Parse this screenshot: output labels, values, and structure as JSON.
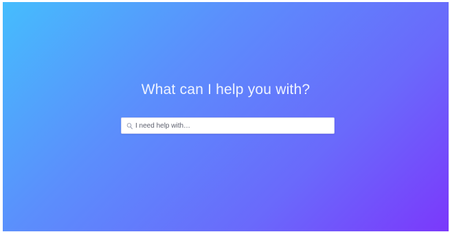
{
  "hero": {
    "headline": "What can I help you with?",
    "gradient_colors": [
      "#45bdfd",
      "#6a69fb",
      "#7b38fb"
    ]
  },
  "search": {
    "placeholder": "I need help with…",
    "value": "",
    "icon": "search-icon"
  }
}
